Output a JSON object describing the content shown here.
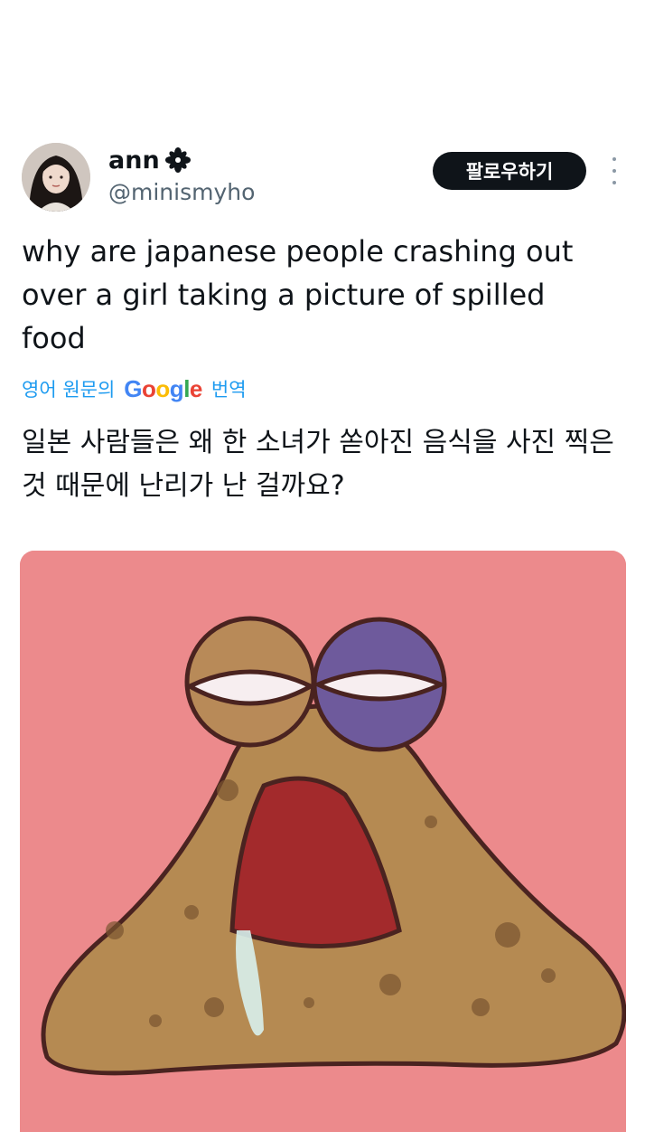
{
  "user": {
    "display_name": "ann",
    "badge_icon": "flower-icon",
    "handle": "@minismyho"
  },
  "follow_label": "팔로우하기",
  "more_icon": "more-vertical-icon",
  "tweet": {
    "text": "why are japanese people crashing out over a girl taking a picture of spilled food"
  },
  "translation": {
    "prefix": "영어 원문의",
    "provider": "Google",
    "suffix": "번역",
    "text": "일본 사람들은 왜 한 소녀가 쏟아진 음식을 사진 찍은 것 때문에 난리가 난 걸까요?"
  },
  "colors": {
    "accent": "#1d9bf0",
    "button_bg": "#0f1419",
    "media_bg": "#ec8a8c",
    "creature_body": "#b58a52"
  }
}
